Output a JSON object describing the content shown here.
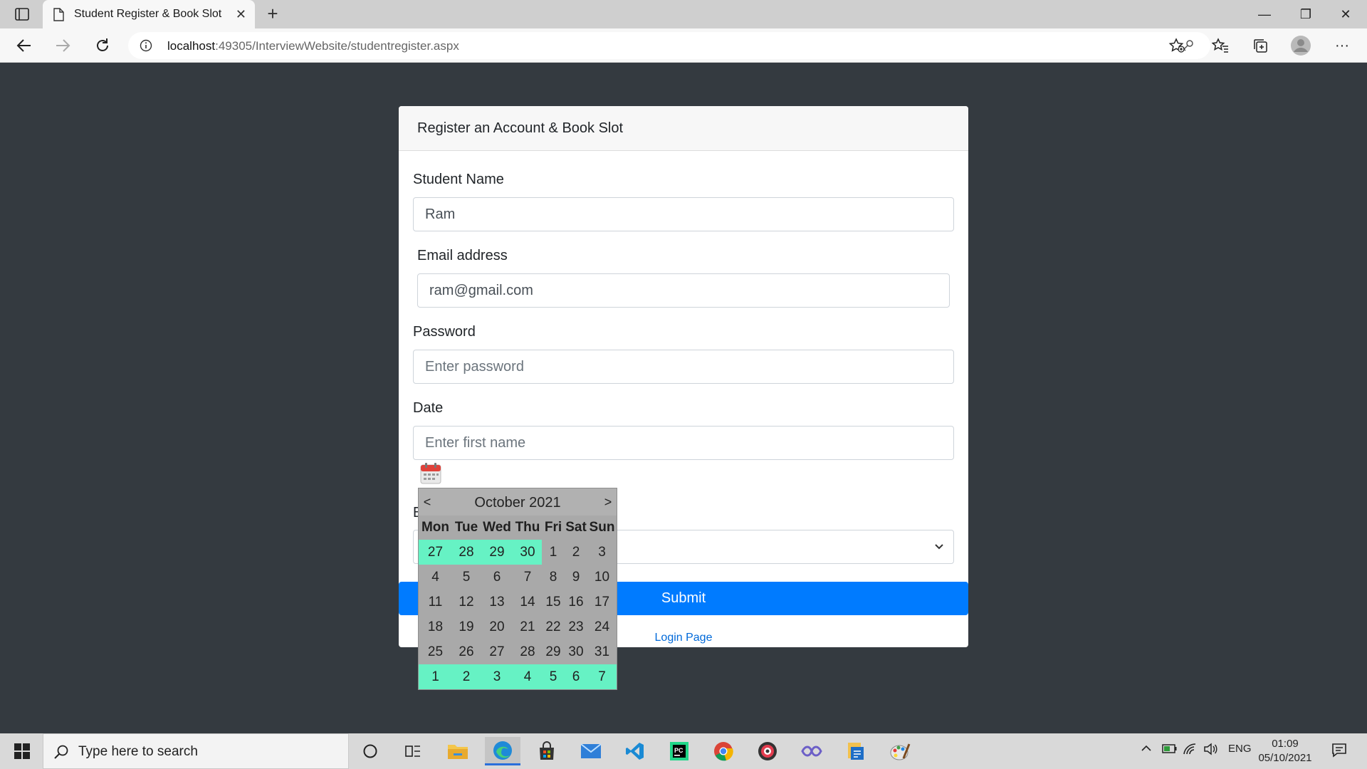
{
  "browser": {
    "tab_title": "Student Register & Book Slot",
    "tab_close": "✕",
    "new_tab": "+",
    "url_host": "localhost",
    "url_path": ":49305/InterviewWebsite/studentregister.aspx",
    "window_controls": [
      "—",
      "❐",
      "✕"
    ],
    "more": "···"
  },
  "form": {
    "header": "Register an Account & Book Slot",
    "student_name_label": "Student Name",
    "student_name_value": "Ram",
    "email_label": "Email address",
    "email_value": "ram@gmail.com",
    "password_label": "Password",
    "password_placeholder": "Enter password",
    "date_label": "Date",
    "date_placeholder": "Enter first name",
    "hidden_label_partial": "E",
    "submit_label": "Submit",
    "login_link": "Login Page"
  },
  "calendar": {
    "prev": "<",
    "next": ">",
    "month_year": "October 2021",
    "weekdays": [
      "Mon",
      "Tue",
      "Wed",
      "Thu",
      "Fri",
      "Sat",
      "Sun"
    ],
    "weeks": [
      [
        {
          "d": "27",
          "o": true
        },
        {
          "d": "28",
          "o": true
        },
        {
          "d": "29",
          "o": true
        },
        {
          "d": "30",
          "o": true
        },
        {
          "d": "1",
          "o": false
        },
        {
          "d": "2",
          "o": false
        },
        {
          "d": "3",
          "o": false
        }
      ],
      [
        {
          "d": "4",
          "o": false
        },
        {
          "d": "5",
          "o": false
        },
        {
          "d": "6",
          "o": false
        },
        {
          "d": "7",
          "o": false
        },
        {
          "d": "8",
          "o": false
        },
        {
          "d": "9",
          "o": false
        },
        {
          "d": "10",
          "o": false
        }
      ],
      [
        {
          "d": "11",
          "o": false
        },
        {
          "d": "12",
          "o": false
        },
        {
          "d": "13",
          "o": false
        },
        {
          "d": "14",
          "o": false
        },
        {
          "d": "15",
          "o": false
        },
        {
          "d": "16",
          "o": false
        },
        {
          "d": "17",
          "o": false
        }
      ],
      [
        {
          "d": "18",
          "o": false
        },
        {
          "d": "19",
          "o": false
        },
        {
          "d": "20",
          "o": false
        },
        {
          "d": "21",
          "o": false
        },
        {
          "d": "22",
          "o": false
        },
        {
          "d": "23",
          "o": false
        },
        {
          "d": "24",
          "o": false
        }
      ],
      [
        {
          "d": "25",
          "o": false
        },
        {
          "d": "26",
          "o": false
        },
        {
          "d": "27",
          "o": false
        },
        {
          "d": "28",
          "o": false
        },
        {
          "d": "29",
          "o": false
        },
        {
          "d": "30",
          "o": false
        },
        {
          "d": "31",
          "o": false
        }
      ],
      [
        {
          "d": "1",
          "o": true
        },
        {
          "d": "2",
          "o": true
        },
        {
          "d": "3",
          "o": true
        },
        {
          "d": "4",
          "o": true
        },
        {
          "d": "5",
          "o": true
        },
        {
          "d": "6",
          "o": true
        },
        {
          "d": "7",
          "o": true
        }
      ]
    ]
  },
  "taskbar": {
    "search_placeholder": "Type here to search",
    "language": "ENG",
    "time": "01:09",
    "date": "05/10/2021",
    "apps": [
      "cortana-icon",
      "task-view-icon",
      "file-explorer-icon",
      "edge-icon",
      "store-icon",
      "mail-icon",
      "vscode-icon",
      "pycharm-icon",
      "chrome-icon",
      "media-player-icon",
      "visual-studio-icon",
      "sql-server-icon",
      "paint-icon"
    ]
  },
  "colors": {
    "page_bg": "#343a40",
    "primary": "#007bff",
    "calendar_bg": "#a9a9a9",
    "calendar_other_month": "#66f2c4"
  }
}
